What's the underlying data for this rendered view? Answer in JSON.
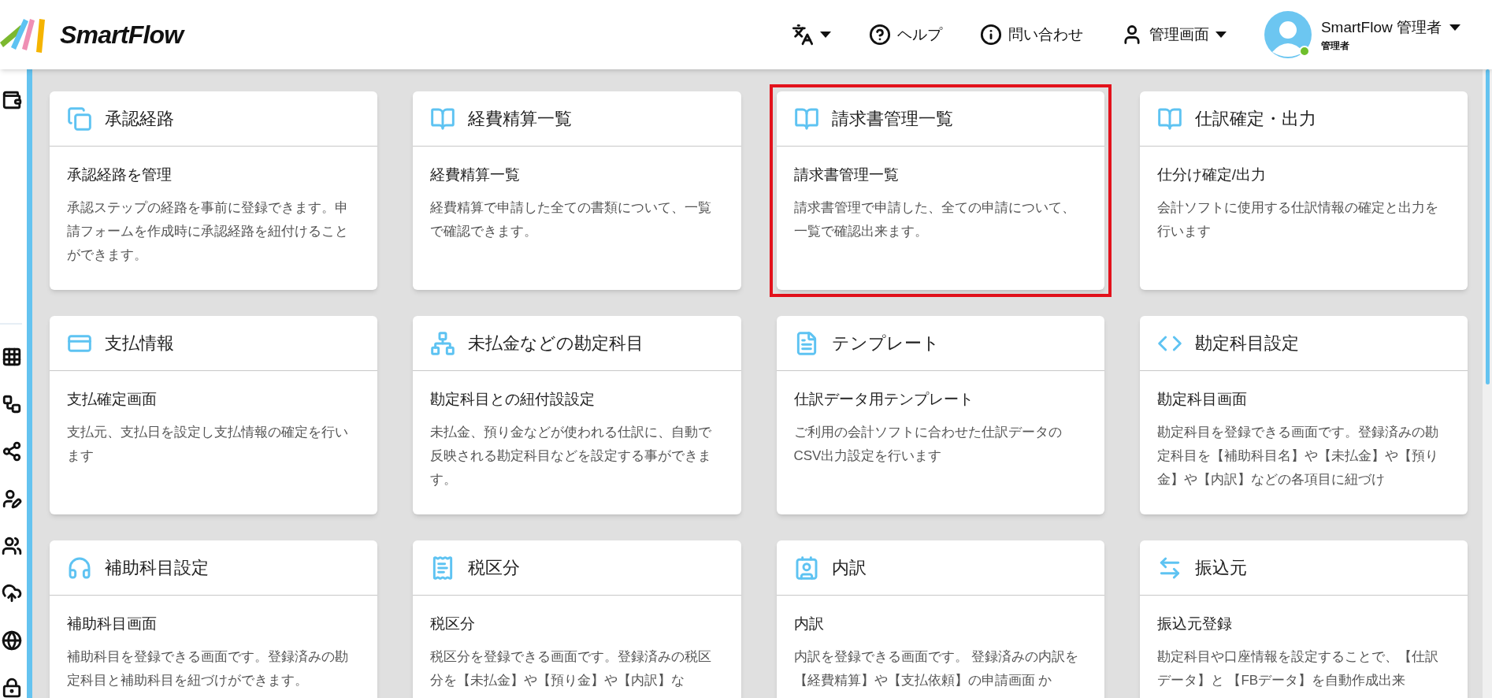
{
  "header": {
    "logo_text": "SmartFlow",
    "nav": [
      {
        "kind": "language"
      },
      {
        "kind": "help",
        "label": "ヘルプ"
      },
      {
        "kind": "contact",
        "label": "問い合わせ"
      },
      {
        "kind": "admin",
        "label": "管理画面"
      }
    ],
    "user": {
      "name": "SmartFlow 管理者",
      "role": "管理者",
      "online": true
    }
  },
  "cards": [
    {
      "title": "承認経路",
      "subtitle": "承認経路を管理",
      "description": "承認ステップの経路を事前に登録できます。申請フォームを作成時に承認経路を紐付けることができます。",
      "selected": false
    },
    {
      "title": "経費精算一覧",
      "subtitle": "経費精算一覧",
      "description": "経費精算で申請した全ての書類について、一覧で確認できます。",
      "selected": false
    },
    {
      "title": "請求書管理一覧",
      "subtitle": "請求書管理一覧",
      "description": "請求書管理で申請した、全ての申請について、一覧で確認出来ます。",
      "selected": true
    },
    {
      "title": "仕訳確定・出力",
      "subtitle": "仕分け確定/出力",
      "description": "会計ソフトに使用する仕訳情報の確定と出力を行います",
      "selected": false
    },
    {
      "title": "支払情報",
      "subtitle": "支払確定画面",
      "description": "支払元、支払日を設定し支払情報の確定を行います",
      "selected": false
    },
    {
      "title": "未払金などの勘定科目",
      "subtitle": "勘定科目との紐付設設定",
      "description": "未払金、預り金などが使われる仕訳に、自動で反映される勘定科目などを設定する事ができます。",
      "selected": false
    },
    {
      "title": "テンプレート",
      "subtitle": "仕訳データ用テンプレート",
      "description": "ご利用の会計ソフトに合わせた仕訳データのCSV出力設定を行います",
      "selected": false
    },
    {
      "title": "勘定科目設定",
      "subtitle": "勘定科目画面",
      "description": "勘定科目を登録できる画面です。登録済みの勘定科目を【補助科目名】や【未払金】や【預り金】や【内訳】などの各項目に紐づけ",
      "selected": false
    },
    {
      "title": "補助科目設定",
      "subtitle": "補助科目画面",
      "description": "補助科目を登録できる画面です。登録済みの勘定科目と補助科目を紐づけができます。",
      "selected": false
    },
    {
      "title": "税区分",
      "subtitle": "税区分",
      "description": "税区分を登録できる画面です。登録済みの税区分を【未払金】や【預り金】や【内訳】な",
      "selected": false
    },
    {
      "title": "内訳",
      "subtitle": "内訳",
      "description": "内訳を登録できる画面です。 登録済みの内訳を【経費精算】や【支払依頼】の申請画面 か",
      "selected": false
    },
    {
      "title": "振込元",
      "subtitle": "振込元登録",
      "description": "勘定科目や口座情報を設定することで、【仕訳データ】と 【FBデータ】を自動作成出来",
      "selected": false
    }
  ]
}
